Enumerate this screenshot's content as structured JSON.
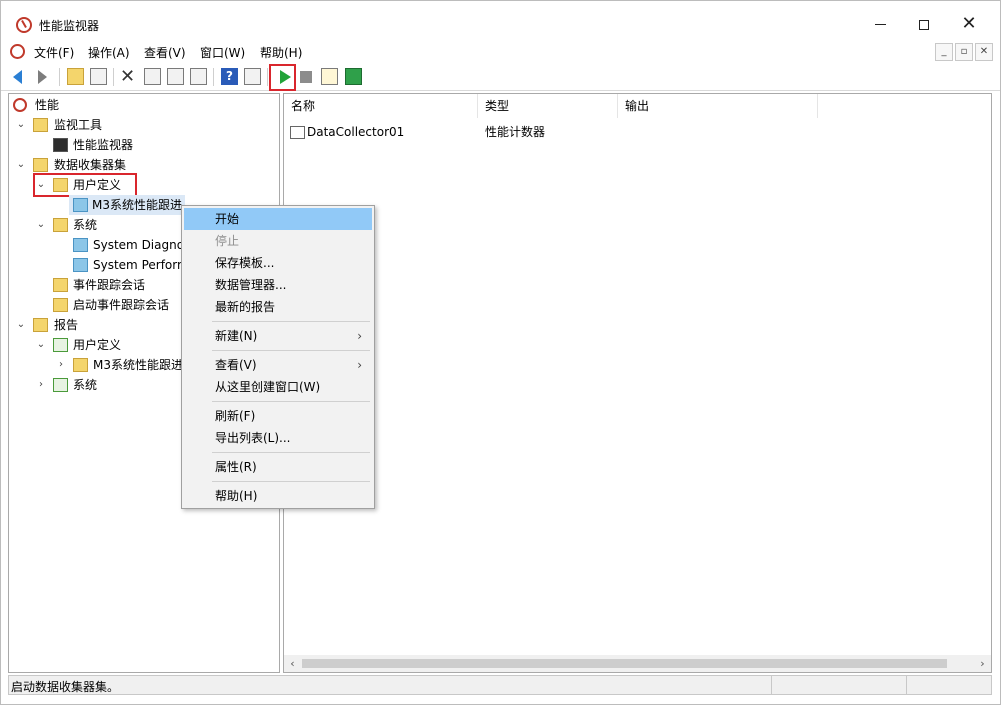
{
  "title_bar": {
    "title": "性能监视器",
    "minimize": "",
    "maximize": "",
    "close": "✕"
  },
  "menubar": {
    "items": [
      "文件(F)",
      "操作(A)",
      "查看(V)",
      "窗口(W)",
      "帮助(H)"
    ]
  },
  "tree": {
    "root": "性能",
    "monitor_tools": "监视工具",
    "perf_monitor": "性能监视器",
    "data_collector_sets": "数据收集器集",
    "user_defined": "用户定义",
    "m3_set": "M3系统性能跟进",
    "system": "系统",
    "sys_diag": "System Diagnos",
    "sys_perf": "System Perform",
    "event_trace": "事件跟踪会话",
    "startup_event_trace": "启动事件跟踪会话",
    "reports": "报告",
    "reports_user_defined": "用户定义",
    "reports_m3": "M3系统性能跟进",
    "reports_system": "系统"
  },
  "list": {
    "columns": [
      "名称",
      "类型",
      "输出"
    ],
    "rows": [
      {
        "name": "DataCollector01",
        "type": "性能计数器",
        "output": ""
      }
    ]
  },
  "context_menu": {
    "items": [
      "开始",
      "停止",
      "保存模板...",
      "数据管理器...",
      "最新的报告",
      "新建(N)",
      "查看(V)",
      "从这里创建窗口(W)",
      "刷新(F)",
      "导出列表(L)...",
      "属性(R)",
      "帮助(H)"
    ]
  },
  "statusbar": {
    "text": "启动数据收集器集。"
  },
  "colors": {
    "highlight": "#91c9f7",
    "annotation_red": "#d9262d",
    "play_green": "#22a339"
  }
}
